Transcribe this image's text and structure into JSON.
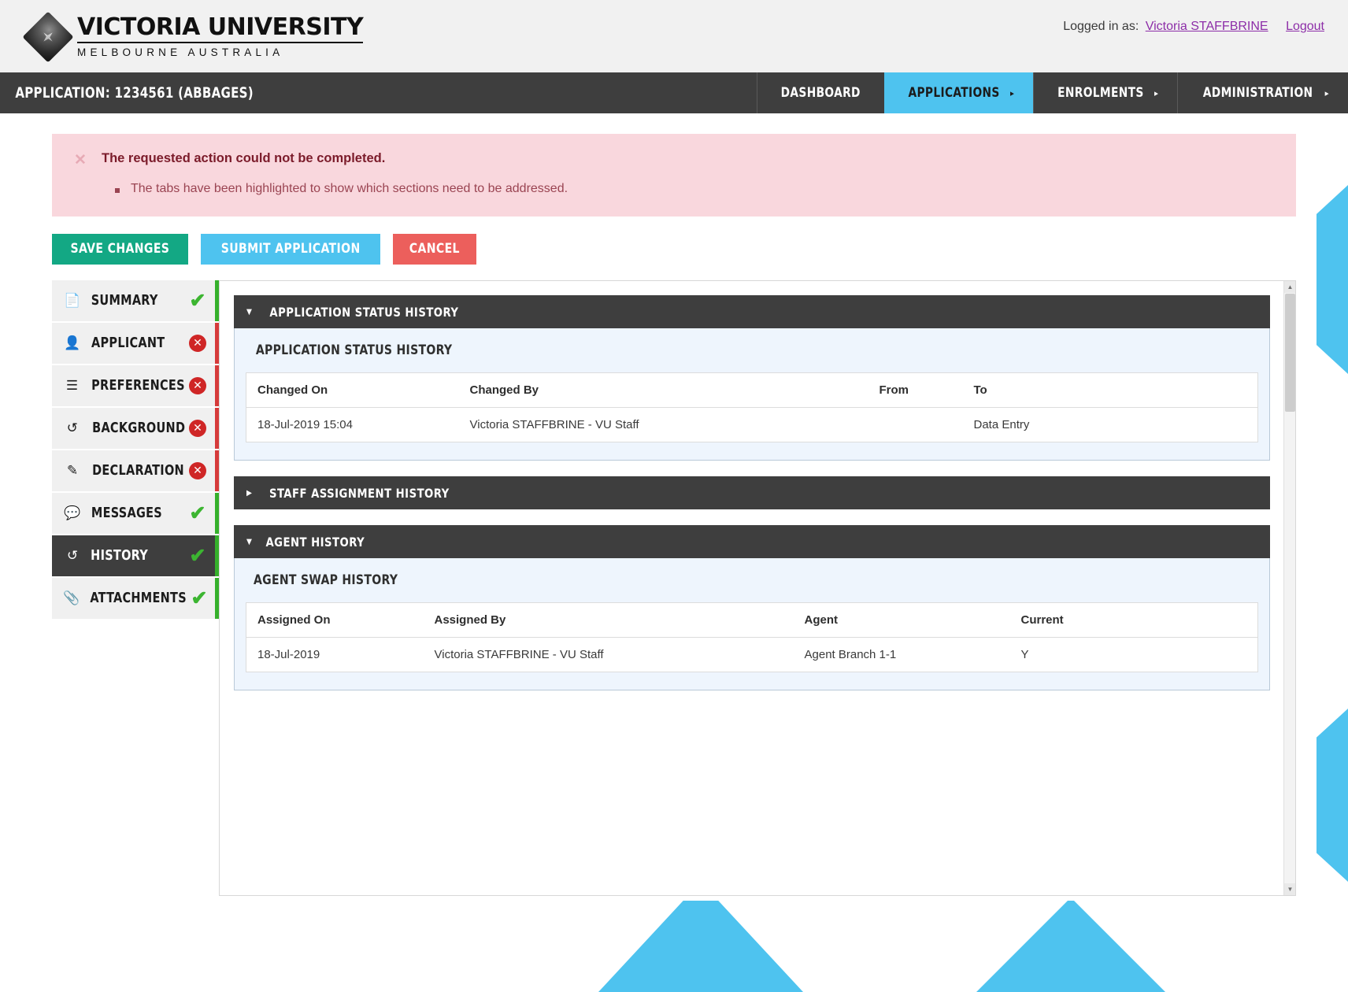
{
  "header": {
    "logo_title": "VICTORIA UNIVERSITY",
    "logo_subtitle": "MELBOURNE AUSTRALIA",
    "logged_in_label": "Logged in as:",
    "user_name": "Victoria STAFFBRINE",
    "logout_label": "Logout"
  },
  "nav": {
    "app_title": "APPLICATION: 1234561 (ABBAGES)",
    "items": [
      {
        "label": "DASHBOARD",
        "caret": "",
        "active": false
      },
      {
        "label": "APPLICATIONS",
        "caret": "▸",
        "active": true
      },
      {
        "label": "ENROLMENTS",
        "caret": "▸",
        "active": false
      },
      {
        "label": "ADMINISTRATION",
        "caret": "▸",
        "active": false
      }
    ]
  },
  "alert": {
    "close": "✕",
    "title": "The requested action could not be completed.",
    "items": [
      "The tabs have been highlighted to show which sections need to be addressed."
    ]
  },
  "actions": {
    "save_label": "SAVE CHANGES",
    "submit_label": "SUBMIT APPLICATION",
    "cancel_label": "CANCEL"
  },
  "sidebar": {
    "items": [
      {
        "label": "SUMMARY",
        "icon": "📄",
        "status": "ok",
        "active": false
      },
      {
        "label": "APPLICANT",
        "icon": "👤",
        "status": "error",
        "active": false
      },
      {
        "label": "PREFERENCES",
        "icon": "☰",
        "status": "error",
        "active": false
      },
      {
        "label": "BACKGROUND",
        "icon": "↺",
        "status": "error",
        "active": false
      },
      {
        "label": "DECLARATION",
        "icon": "✎",
        "status": "error",
        "active": false
      },
      {
        "label": "MESSAGES",
        "icon": "💬",
        "status": "ok",
        "active": false
      },
      {
        "label": "HISTORY",
        "icon": "↺",
        "status": "ok",
        "active": true
      },
      {
        "label": "ATTACHMENTS",
        "icon": "📎",
        "status": "ok",
        "active": false
      }
    ],
    "status_ok_mark": "✔",
    "status_err_mark": "✕"
  },
  "panels": {
    "status_history": {
      "header": "APPLICATION STATUS HISTORY",
      "expanded": true,
      "arrow": "▼",
      "subtitle": "APPLICATION STATUS HISTORY",
      "columns": [
        "Changed On",
        "Changed By",
        "From",
        "To"
      ],
      "rows": [
        {
          "changed_on": "18-Jul-2019 15:04",
          "changed_by": "Victoria STAFFBRINE - VU Staff",
          "from": "",
          "to": "Data Entry"
        }
      ]
    },
    "staff_assignment_history": {
      "header": "STAFF ASSIGNMENT HISTORY",
      "expanded": false,
      "arrow": "▶"
    },
    "agent_history": {
      "header": "AGENT HISTORY",
      "expanded": true,
      "arrow": "▼",
      "subtitle": "AGENT SWAP HISTORY",
      "columns": [
        "Assigned On",
        "Assigned By",
        "Agent",
        "Current"
      ],
      "rows": [
        {
          "assigned_on": "18-Jul-2019",
          "assigned_by": "Victoria STAFFBRINE - VU Staff",
          "agent": "Agent Branch 1-1",
          "current": "Y"
        }
      ]
    }
  },
  "scrollbar": {
    "up_arrow": "▲",
    "down_arrow": "▼"
  },
  "colors": {
    "accent_cyan": "#4ec3ef",
    "dark": "#3e3e3e",
    "save_green": "#13a884",
    "cancel_red": "#ec5f5c",
    "alert_bg": "#f9d7dd",
    "status_ok": "#35b02b",
    "status_err": "#d63a3a"
  }
}
